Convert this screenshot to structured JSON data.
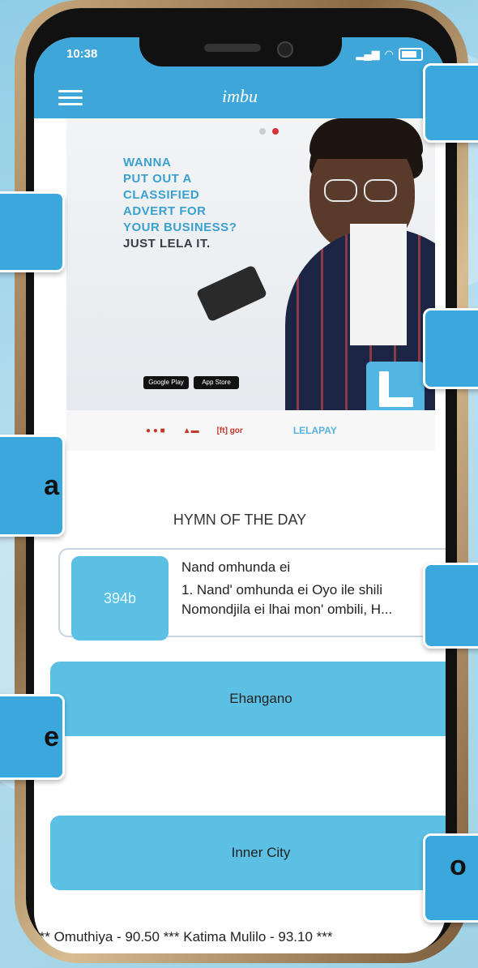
{
  "status_bar": {
    "time": "10:38"
  },
  "app_bar": {
    "title": "imbu"
  },
  "banner": {
    "lines": [
      "WANNA",
      "PUT OUT A",
      "CLASSIFIED",
      "ADVERT FOR",
      "YOUR BUSINESS?"
    ],
    "tagline": "JUST LELA IT.",
    "store_badge_1": "Google Play",
    "store_badge_2": "App Store"
  },
  "sponsors": {
    "lelapay": "LELAPAY",
    "other": "[ft] gor"
  },
  "hymn": {
    "heading": "HYMN OF THE DAY",
    "number": "394b",
    "title": "Nand omhunda ei",
    "excerpt": "1. Nand' omhunda ei Oyo ile shili Nomondjila ei lhai mon' ombili, H..."
  },
  "stations": [
    {
      "label": "Ehangano"
    },
    {
      "label": "Inner City"
    }
  ],
  "ticker": "*** Omuthiya - 90.50 *** Katima Mulilo - 93.10 ***",
  "callouts": {
    "left_3": "a",
    "left_4": "e",
    "right_5": "o"
  },
  "colors": {
    "accent": "#3ea6d8",
    "button": "#5bc0e4",
    "callout": "#3aa7dd"
  }
}
